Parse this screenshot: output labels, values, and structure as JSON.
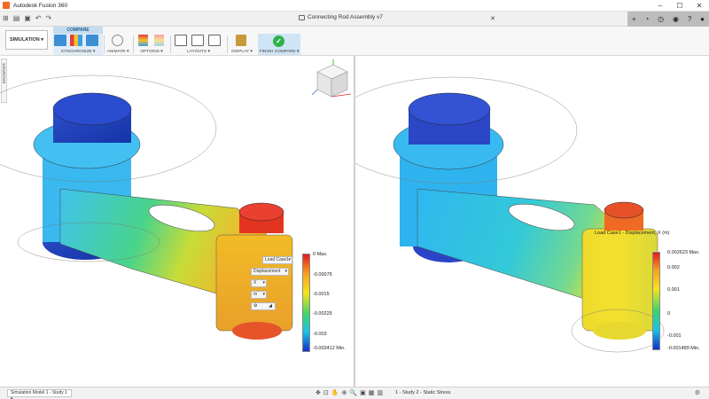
{
  "app": {
    "title": "Autodesk Fusion 360"
  },
  "window": {
    "minimize": "–",
    "maximize": "☐",
    "close": "✕"
  },
  "document": {
    "name": "Connecting Rod Assembly v7"
  },
  "ribbon": {
    "workspace": "SIMULATION ▾",
    "compare_tab": "COMPARE",
    "groups": {
      "synchronize": "SYNCHRONIZE ▾",
      "animate": "ANIMATE ▾",
      "options": "OPTIONS ▾",
      "layouts": "LAYOUTS ▾",
      "display": "DISPLAY ▾",
      "finish": "FINISH COMPARE ▾"
    }
  },
  "browser": {
    "label": "BROWSER"
  },
  "left_view": {
    "legend_ticks": [
      "0 Max.",
      "-0.00075",
      "-0.0015",
      "-0.00225",
      "-0.003",
      "-0.003412 Min."
    ],
    "controls": {
      "load_case": "Load Case1",
      "result": "Displacement",
      "component": "X",
      "unit": "m"
    }
  },
  "right_view": {
    "legend_title": "Load Case1 - Displacement, X (m)",
    "legend_ticks": [
      "0.002623 Max.",
      "0.002",
      "0.001",
      "0",
      "-0.001",
      "-0.001489 Min."
    ]
  },
  "bottom": {
    "sim_model": "Simulation Model 1 - Study 1 ▾",
    "study_label": "1 - Study 2 - Static Stress"
  },
  "colors": {
    "accent": "#2b7fc1",
    "finish_green": "#2eb24a",
    "compare_bg": "#dfecf7"
  }
}
